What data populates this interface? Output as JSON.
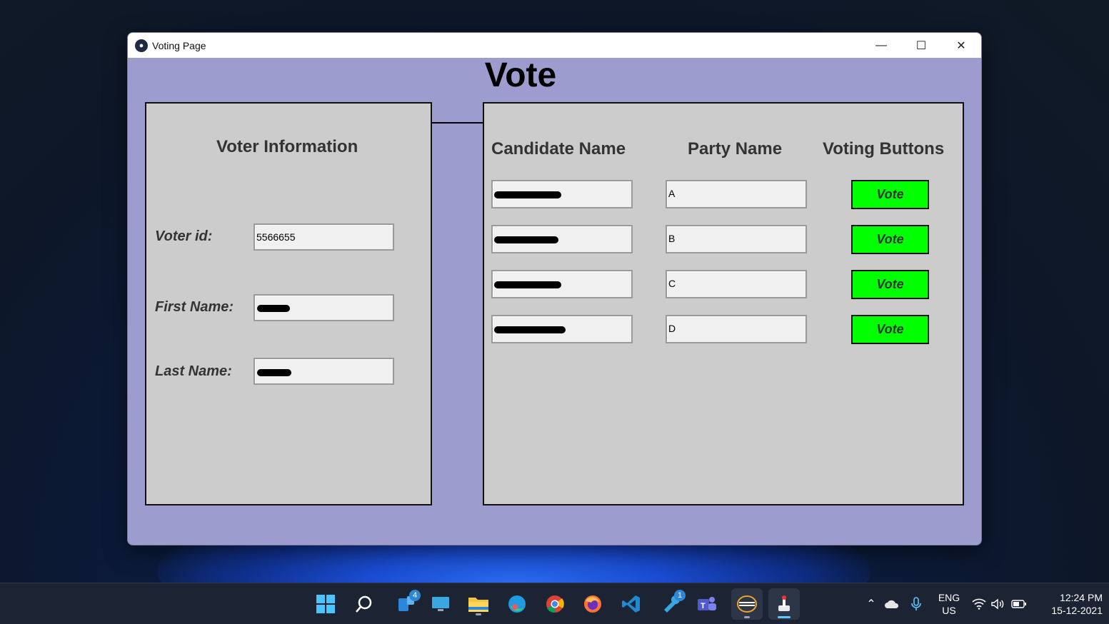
{
  "window": {
    "title": "Voting Page"
  },
  "page": {
    "heading": "Vote"
  },
  "voter_panel": {
    "title": "Voter Information",
    "fields": [
      {
        "label": "Voter id:",
        "value": "5566655"
      },
      {
        "label": "First Name:",
        "value": ""
      },
      {
        "label": "Last Name:",
        "value": ""
      }
    ]
  },
  "candidates_panel": {
    "headers": {
      "candidate": "Candidate Name",
      "party": "Party Name",
      "voting": "Voting Buttons"
    },
    "rows": [
      {
        "candidate": "",
        "party": "A",
        "button": "Vote"
      },
      {
        "candidate": "",
        "party": "B",
        "button": "Vote"
      },
      {
        "candidate": "",
        "party": "C",
        "button": "Vote"
      },
      {
        "candidate": "",
        "party": "D",
        "button": "Vote"
      }
    ]
  },
  "colors": {
    "window_bg": "#9c9ccf",
    "panel_bg": "#cccccc",
    "vote_button": "#00ff00"
  },
  "taskbar": {
    "icons": [
      {
        "name": "start-icon"
      },
      {
        "name": "search-icon"
      },
      {
        "name": "widgets-icon",
        "badge": "4"
      },
      {
        "name": "desktop-icon"
      },
      {
        "name": "file-explorer-icon"
      },
      {
        "name": "edge-icon"
      },
      {
        "name": "chrome-icon"
      },
      {
        "name": "firefox-icon"
      },
      {
        "name": "vscode-icon"
      },
      {
        "name": "tools-icon",
        "badge": "1"
      },
      {
        "name": "teams-icon"
      },
      {
        "name": "python-app-icon"
      },
      {
        "name": "voting-app-icon"
      }
    ],
    "language": "ENG",
    "region": "US",
    "time": "12:24 PM",
    "date": "15-12-2021"
  }
}
